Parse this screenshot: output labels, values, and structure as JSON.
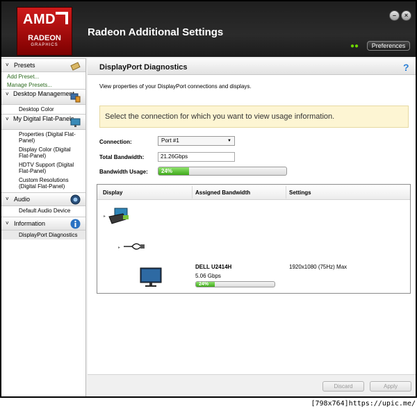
{
  "window": {
    "title": "Radeon Additional Settings",
    "logo": {
      "brand": "AMD",
      "product": "RADEON",
      "sub": "GRAPHICS"
    },
    "minimize_label": "–",
    "close_label": "×",
    "connection_indicator": "●●",
    "preferences_label": "Preferences"
  },
  "sidebar": {
    "presets": {
      "label": "Presets",
      "links": [
        "Add Preset...",
        "Manage Presets..."
      ]
    },
    "desktop_management": {
      "label": "Desktop Management",
      "items": [
        "Desktop Color"
      ]
    },
    "digital_flat_panels": {
      "label": "My Digital Flat-Panels",
      "items": [
        "Properties (Digital Flat-Panel)",
        "Display Color (Digital Flat-Panel)",
        "HDTV Support (Digital Flat-Panel)",
        "Custom Resolutions (Digital Flat-Panel)"
      ]
    },
    "audio": {
      "label": "Audio",
      "items": [
        "Default Audio Device"
      ]
    },
    "information": {
      "label": "Information",
      "items": [
        "DisplayPort Diagnostics"
      ]
    }
  },
  "main": {
    "title": "DisplayPort Diagnostics",
    "help_label": "?",
    "description": "View properties of your DisplayPort connections and displays.",
    "notice": "Select the connection for which you want to view usage information.",
    "form": {
      "connection_label": "Connection:",
      "connection_value": "Port #1",
      "total_bandwidth_label": "Total Bandwidth:",
      "total_bandwidth_value": "21.26Gbps",
      "bandwidth_usage_label": "Bandwidth Usage:",
      "bandwidth_usage_text": "24%",
      "bandwidth_usage_fraction": 0.24
    },
    "table": {
      "columns": [
        "Display",
        "Assigned Bandwidth",
        "Settings"
      ],
      "rows": [
        {
          "name": "DELL U2414H",
          "bandwidth": "5.06 Gbps",
          "usage_text": "24%",
          "usage_fraction": 0.24,
          "settings": "1920x1080 (75Hz) Max"
        }
      ]
    },
    "buttons": {
      "discard": "Discard",
      "apply": "Apply"
    }
  },
  "watermark": "[798x764]https://upic.me/",
  "colors": {
    "header_bg": "#222222",
    "accent_green": "#3fa91a",
    "notice_bg": "#fdf5d3",
    "link_green": "#2d6b1f",
    "help_blue": "#2a7fd6"
  },
  "icons": [
    "preset-icon",
    "desktop-management-icon",
    "flat-panel-icon",
    "audio-icon",
    "information-icon",
    "gpu-card-icon",
    "displayport-cable-icon",
    "monitor-icon"
  ]
}
